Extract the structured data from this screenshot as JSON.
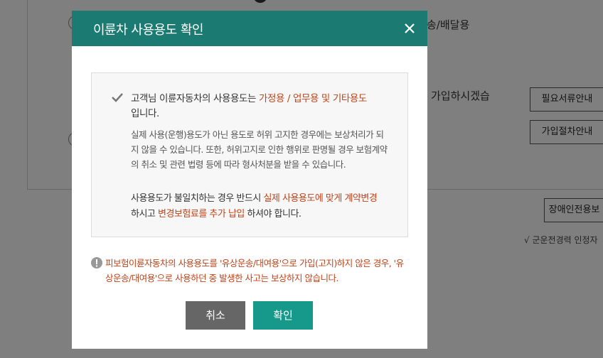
{
  "background": {
    "delivery_text": "송/배달용",
    "question_text": "가입하시겠습",
    "required_docs_button": "필요서류안내",
    "join_procedure_button": "가입절차안내",
    "disability_button": "장애인전용보",
    "military_note": "√ 군운전경력 인정자"
  },
  "modal": {
    "title": "이륜차 사용용도 확인",
    "check_line": {
      "prefix": "고객님 이륜자동차의 사용용도는 ",
      "highlight": "가정용 / 업무용 및 기타용도",
      "suffix": "입니다."
    },
    "notice": "실제 사용(운행)용도가 아닌 용도로 허위 고지한 경우에는 보상처리가 되지 않을 수 있습니다. 또한, 허위고지로 인한 행위로 판명될 경우 보험계약의 취소 및 관련 법령 등에 따라 형사처분을 받을 수 있습니다.",
    "instruction": {
      "part1": "사용용도가 불일치하는 경우 반드시 ",
      "highlight1": "실제 사용용도에 맞게 계약변경",
      "part2": " 하시고 ",
      "highlight2": "변경보험료를 추가 납입",
      "part3": " 하셔야 합니다."
    },
    "warning": "피보험이륜자동차의 사용용도를 '유상운송/대여용'으로 가입(고지)하지 않은 경우, '유상운송/대여용'으로 사용하던 중 발생한 사고는 보상하지 않습니다.",
    "cancel_label": "취소",
    "confirm_label": "확인"
  },
  "colors": {
    "header": "#1b7b72",
    "highlight": "#c0431a",
    "confirm": "#16998a",
    "cancel": "#666666"
  },
  "icons": [
    "close-icon",
    "check-icon",
    "warning-icon"
  ]
}
